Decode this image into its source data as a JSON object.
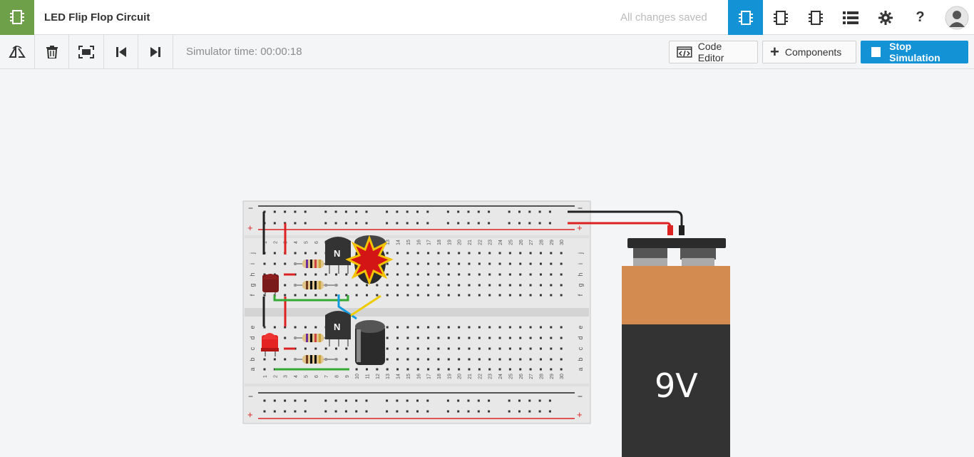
{
  "header": {
    "title": "LED Flip Flop Circuit",
    "status": "All changes saved",
    "icons": [
      "circuit-view-icon",
      "schematic-view-icon",
      "component-list-icon",
      "list-icon",
      "settings-icon",
      "help-icon",
      "user-avatar-icon"
    ]
  },
  "toolbar": {
    "simulator_time": "Simulator time: 00:00:18",
    "code_editor_label": "Code Editor",
    "components_label": "Components",
    "stop_label": "Stop Simulation"
  },
  "breadboard": {
    "top_numbers": [
      "1",
      "2",
      "3",
      "4",
      "5",
      "6",
      "7",
      "8",
      "9",
      "10",
      "11",
      "12",
      "13",
      "14",
      "15",
      "16",
      "17",
      "18",
      "19",
      "20",
      "21",
      "22",
      "23",
      "24",
      "25",
      "26",
      "27",
      "28",
      "29",
      "30"
    ],
    "rows_top": [
      "j",
      "i",
      "h",
      "g",
      "f"
    ],
    "rows_bottom": [
      "e",
      "d",
      "c",
      "b",
      "a"
    ],
    "transistor_label_1": "N",
    "transistor_label_2": "N",
    "rail_minus": "−",
    "rail_plus": "+"
  },
  "battery": {
    "label": "9V"
  },
  "colors": {
    "accent": "#1393d6",
    "logo": "#6ea04a",
    "battery_top": "#d38b4f",
    "battery_body": "#333333"
  }
}
